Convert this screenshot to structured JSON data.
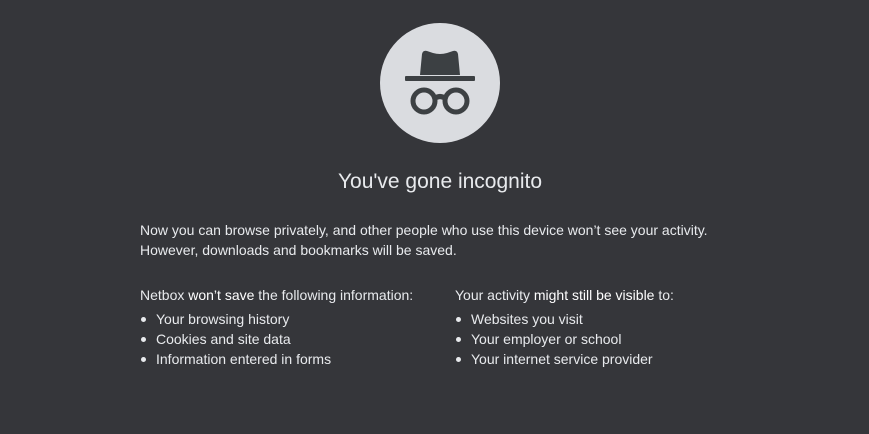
{
  "title": "You've gone incognito",
  "intro": {
    "line1": "Now you can browse privately, and other people who use this device won’t see your activity.",
    "line2": "However, downloads and bookmarks will be saved."
  },
  "left_column": {
    "heading_prefix": "Netbox ",
    "heading_emphasis": "won’t save",
    "heading_suffix": " the following information:",
    "items": [
      {
        "label": "Your browsing history"
      },
      {
        "label": "Cookies and site data"
      },
      {
        "label": "Information entered in forms"
      }
    ]
  },
  "right_column": {
    "heading_prefix": "Your activity ",
    "heading_emphasis": "might still be visible",
    "heading_suffix": " to:",
    "items": [
      {
        "label": "Websites you visit"
      },
      {
        "label": "Your employer or school"
      },
      {
        "label": "Your internet service provider"
      }
    ]
  },
  "colors": {
    "background": "#35363a",
    "icon_circle": "#dadce0",
    "icon_glyph": "#3c4043",
    "text": "#e8eaed"
  },
  "icons": {
    "hero": "incognito-icon"
  }
}
